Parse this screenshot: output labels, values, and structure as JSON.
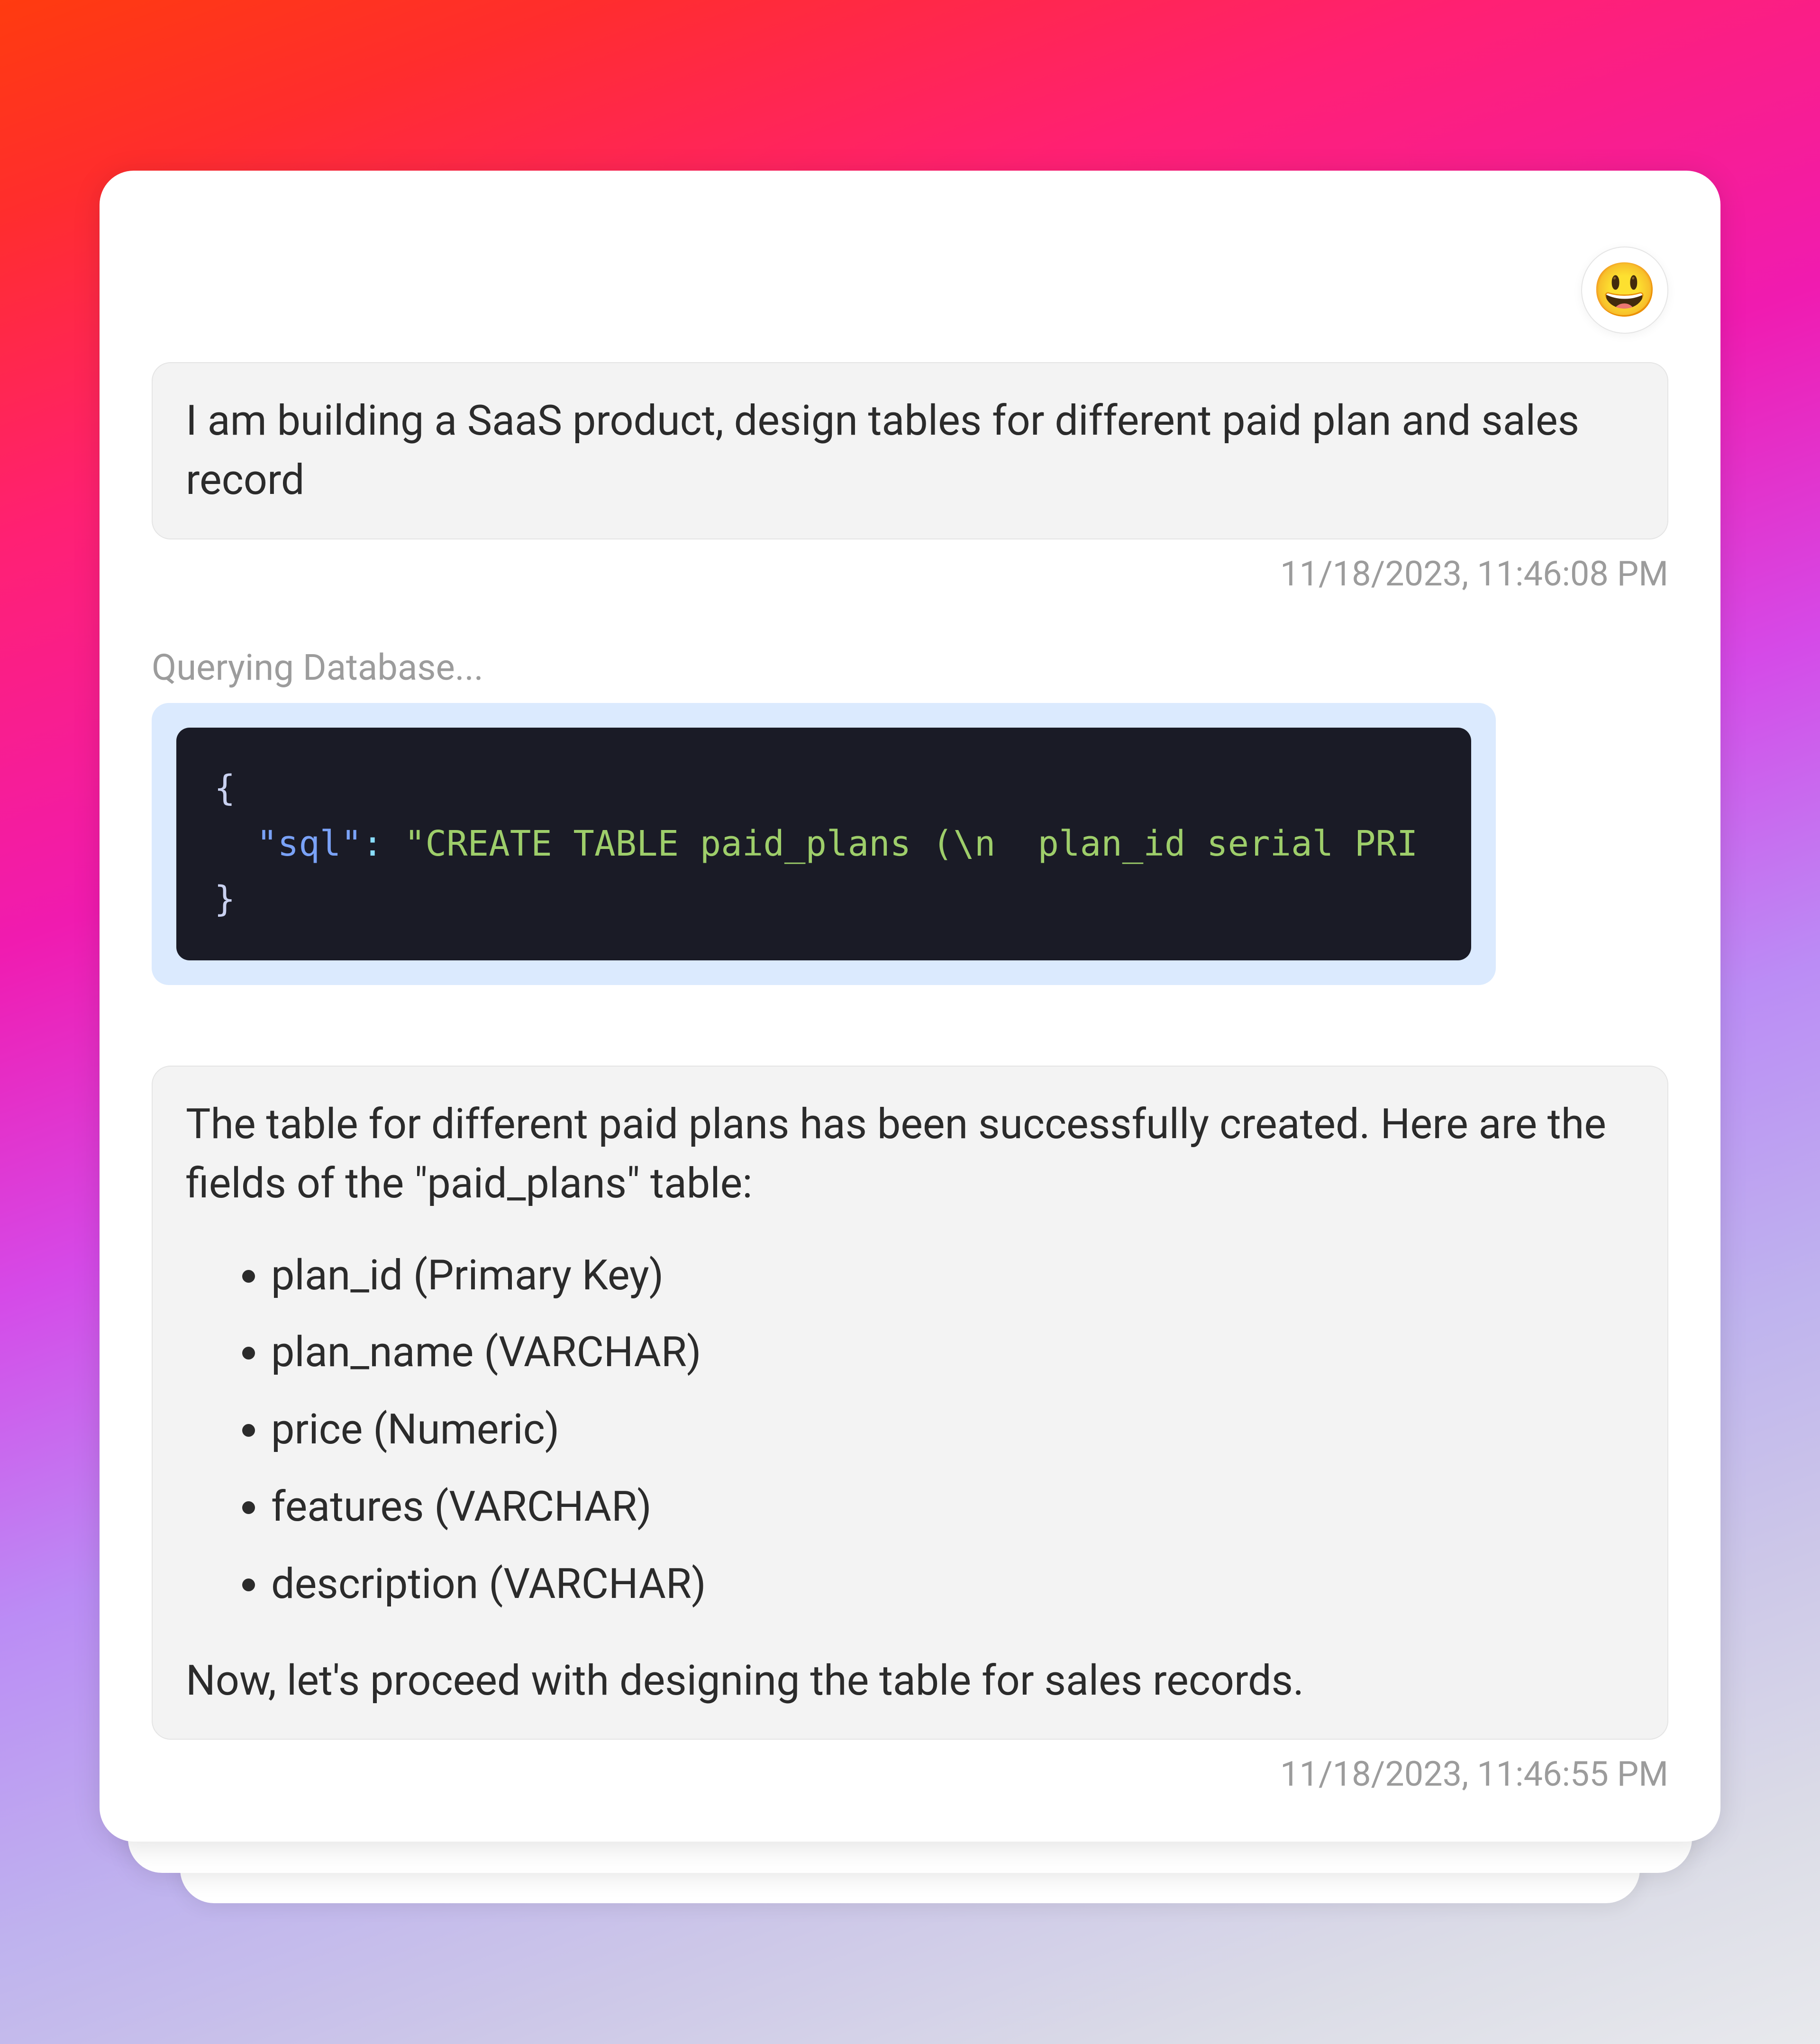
{
  "avatar_emoji": "😃",
  "user_message": {
    "text": "I am building a SaaS product, design tables for different paid plan and sales record",
    "timestamp": "11/18/2023, 11:46:08 PM"
  },
  "status_text": "Querying Database...",
  "code": {
    "brace_open": "{",
    "key": "\"sql\"",
    "colon": ": ",
    "value": "\"CREATE TABLE paid_plans (\\n  plan_id serial PRI",
    "brace_close": "}",
    "indent": "  "
  },
  "assistant_message": {
    "intro": "The table for different paid plans has been successfully created. Here are the fields of the \"paid_plans\" table:",
    "fields": [
      "plan_id (Primary Key)",
      "plan_name (VARCHAR)",
      "price (Numeric)",
      "features (VARCHAR)",
      "description (VARCHAR)"
    ],
    "outro": "Now, let's proceed with designing the table for sales records.",
    "timestamp": "11/18/2023, 11:46:55 PM"
  }
}
